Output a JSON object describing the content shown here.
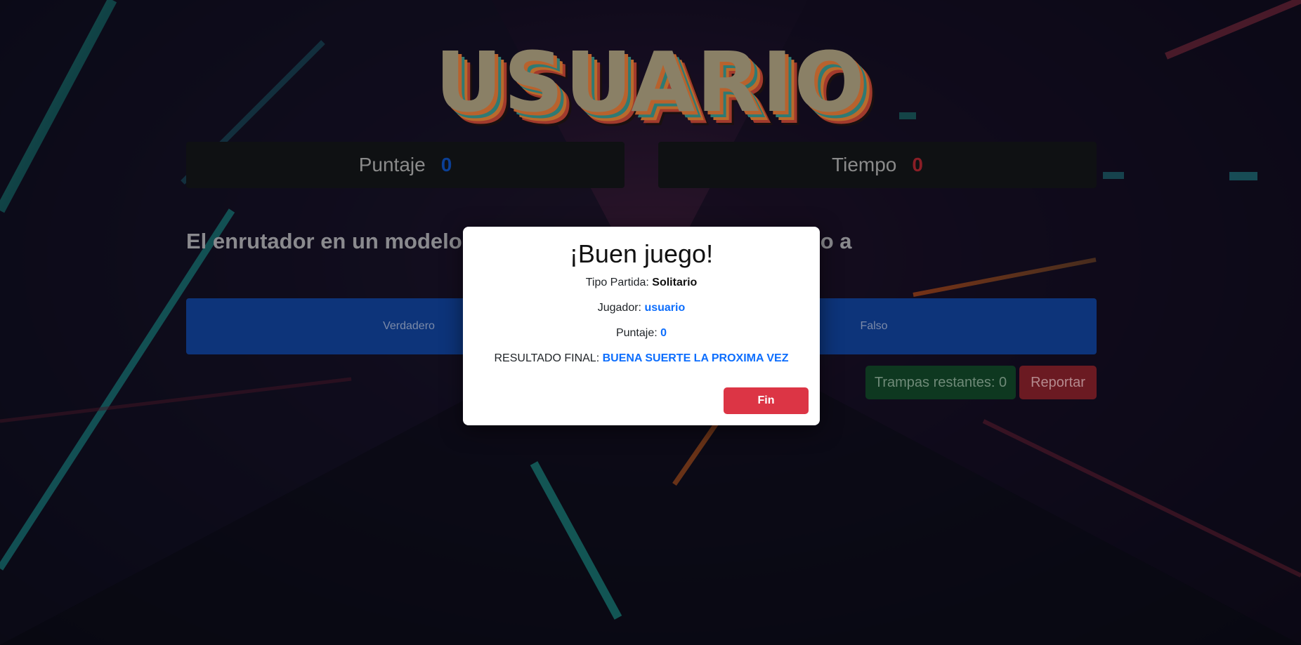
{
  "title": "USUARIO",
  "score_panel": {
    "label": "Puntaje",
    "value": "0"
  },
  "time_panel": {
    "label": "Tiempo",
    "value": "0"
  },
  "question": "El enrutador en un modelo de red... las operaciones de acceso a",
  "answers": {
    "true_label": "Verdadero",
    "false_label": "Falso"
  },
  "traps_button": "Trampas restantes: 0",
  "report_button": "Reportar",
  "modal": {
    "heading": "¡Buen juego!",
    "game_type_label": "Tipo Partida:",
    "game_type_value": "Solitario",
    "player_label": "Jugador:",
    "player_value": "usuario",
    "score_label": "Puntaje:",
    "score_value": "0",
    "result_label": "RESULTADO FINAL:",
    "result_value": "BUENA SUERTE LA PROXIMA VEZ",
    "end_button": "Fin"
  },
  "colors": {
    "accent_blue": "#0d6efd",
    "danger_red": "#dc3545",
    "panel_dark": "#0f1113"
  }
}
